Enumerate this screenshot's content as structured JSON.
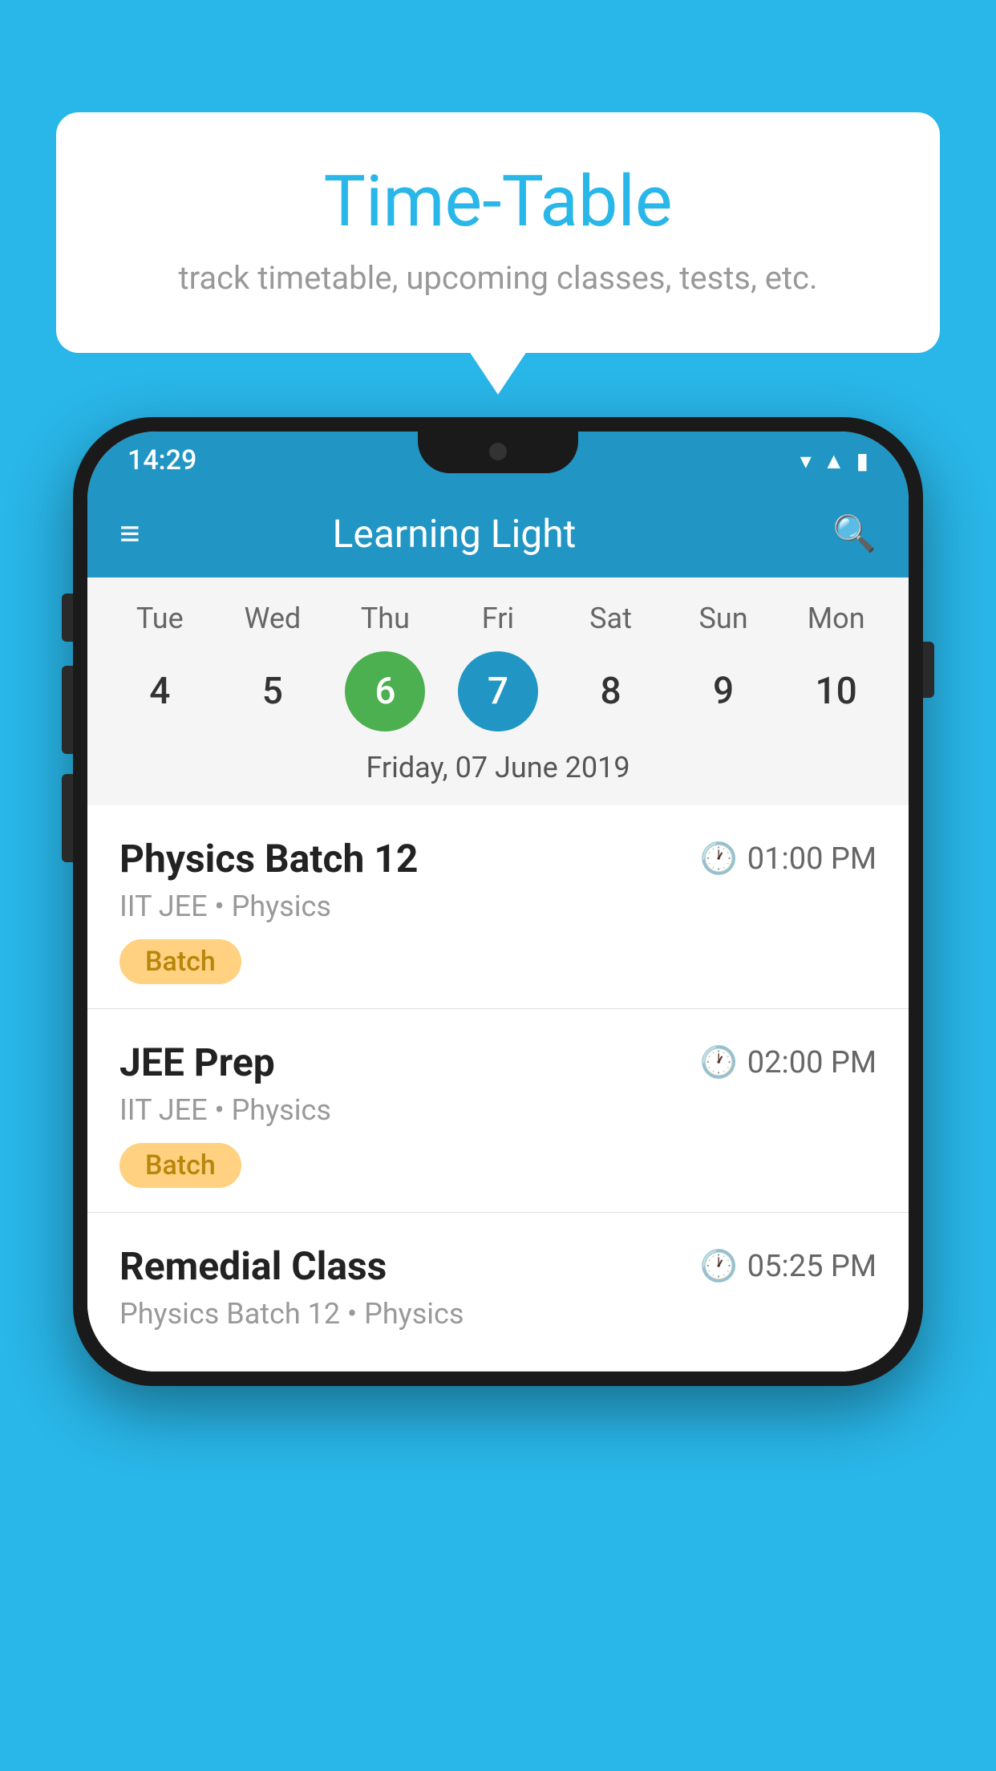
{
  "background_color": "#29b6e8",
  "speech_bubble": {
    "title": "Time-Table",
    "subtitle": "track timetable, upcoming classes, tests, etc."
  },
  "phone": {
    "status_bar": {
      "time": "14:29"
    },
    "app_header": {
      "title": "Learning Light"
    },
    "calendar": {
      "days": [
        "Tue",
        "Wed",
        "Thu",
        "Fri",
        "Sat",
        "Sun",
        "Mon"
      ],
      "dates": [
        "4",
        "5",
        "6",
        "7",
        "8",
        "9",
        "10"
      ],
      "today_index": 2,
      "selected_index": 3,
      "selected_label": "Friday, 07 June 2019"
    },
    "schedule_items": [
      {
        "title": "Physics Batch 12",
        "time": "01:00 PM",
        "meta": "IIT JEE • Physics",
        "badge": "Batch"
      },
      {
        "title": "JEE Prep",
        "time": "02:00 PM",
        "meta": "IIT JEE • Physics",
        "badge": "Batch"
      },
      {
        "title": "Remedial Class",
        "time": "05:25 PM",
        "meta": "Physics Batch 12 • Physics",
        "badge": null
      }
    ]
  }
}
